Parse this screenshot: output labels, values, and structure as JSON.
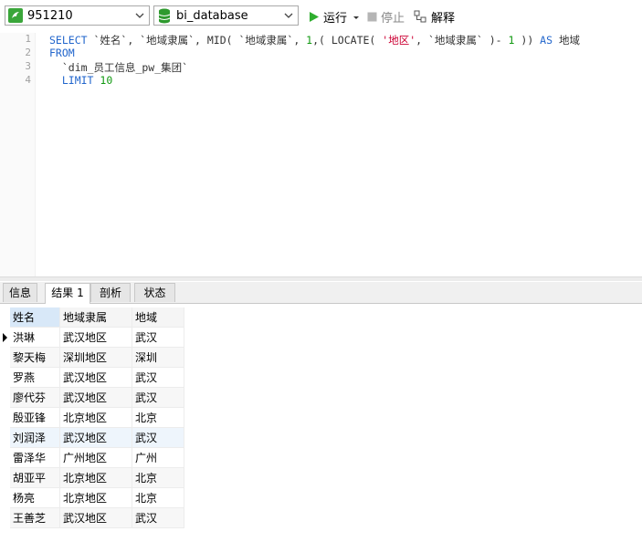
{
  "toolbar": {
    "connection": "951210",
    "database": "bi_database",
    "run_label": "运行",
    "stop_label": "停止",
    "explain_label": "解释"
  },
  "editor": {
    "line_numbers": [
      "1",
      "2",
      "3",
      "4"
    ],
    "lines": [
      [
        {
          "t": "SELECT",
          "c": "kw"
        },
        {
          "t": " `姓名`, `地域隶属`, MID( `地域隶属`, ",
          "c": ""
        },
        {
          "t": "1",
          "c": "num"
        },
        {
          "t": ",( LOCATE( ",
          "c": ""
        },
        {
          "t": "'地区'",
          "c": "str"
        },
        {
          "t": ", `地域隶属` )- ",
          "c": ""
        },
        {
          "t": "1",
          "c": "num"
        },
        {
          "t": " )) ",
          "c": ""
        },
        {
          "t": "AS",
          "c": "kw"
        },
        {
          "t": " 地域",
          "c": ""
        }
      ],
      [
        {
          "t": "FROM",
          "c": "kw"
        }
      ],
      [
        {
          "t": "  `dim_员工信息_pw_集团`",
          "c": ""
        }
      ],
      [
        {
          "t": "  ",
          "c": ""
        },
        {
          "t": "LIMIT",
          "c": "kw"
        },
        {
          "t": " ",
          "c": ""
        },
        {
          "t": "10",
          "c": "num"
        }
      ]
    ]
  },
  "tabs": [
    "信息",
    "结果 1",
    "剖析",
    "状态"
  ],
  "active_tab": 1,
  "result": {
    "columns": [
      "姓名",
      "地域隶属",
      "地域"
    ],
    "rows": [
      [
        "洪琳",
        "武汉地区",
        "武汉"
      ],
      [
        "黎天梅",
        "深圳地区",
        "深圳"
      ],
      [
        "罗燕",
        "武汉地区",
        "武汉"
      ],
      [
        "廖代芬",
        "武汉地区",
        "武汉"
      ],
      [
        "殷亚锋",
        "北京地区",
        "北京"
      ],
      [
        "刘润泽",
        "武汉地区",
        "武汉"
      ],
      [
        "雷泽华",
        "广州地区",
        "广州"
      ],
      [
        "胡亚平",
        "北京地区",
        "北京"
      ],
      [
        "杨亮",
        "北京地区",
        "北京"
      ],
      [
        "王善芝",
        "武汉地区",
        "武汉"
      ]
    ],
    "current_row": 0
  }
}
